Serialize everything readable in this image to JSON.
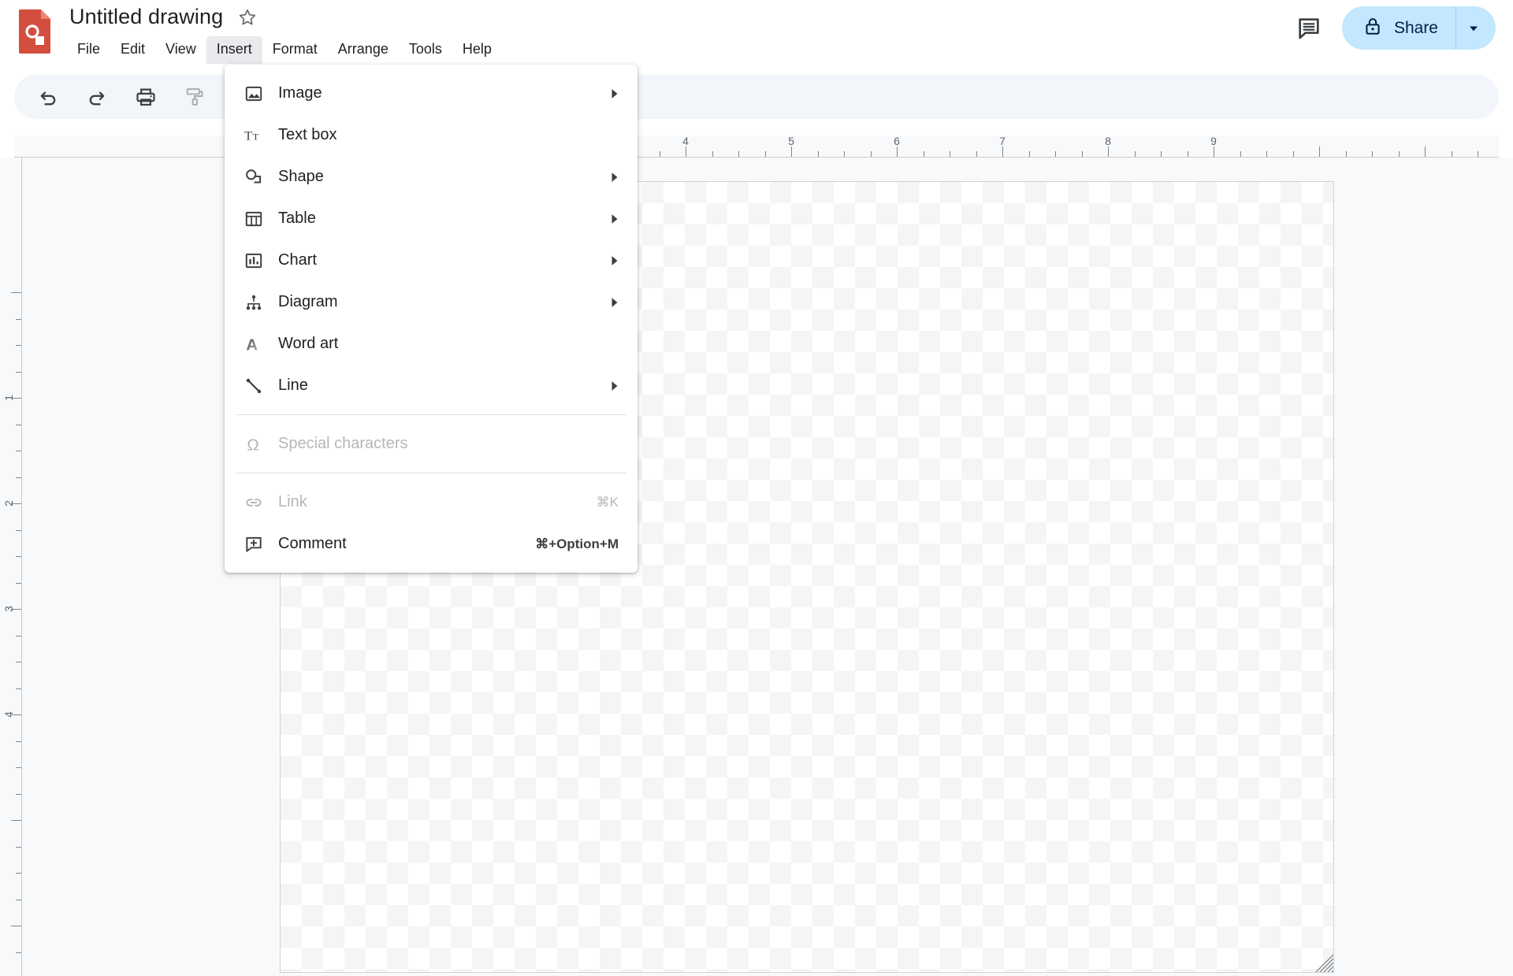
{
  "app": {
    "logo_icon": "google-drawings-logo",
    "logo_color": "#d34e3e"
  },
  "header": {
    "doc_title": "Untitled drawing",
    "star_icon": "star-outline-icon",
    "comment_history_icon": "comment-history-icon",
    "share": {
      "label": "Share",
      "lock_icon": "lock-icon",
      "caret_icon": "chevron-down-icon",
      "bg_color": "#c2e7ff",
      "text_color": "#041e49"
    }
  },
  "menubar": {
    "items": [
      {
        "label": "File",
        "active": false
      },
      {
        "label": "Edit",
        "active": false
      },
      {
        "label": "View",
        "active": false
      },
      {
        "label": "Insert",
        "active": true
      },
      {
        "label": "Format",
        "active": false
      },
      {
        "label": "Arrange",
        "active": false
      },
      {
        "label": "Tools",
        "active": false
      },
      {
        "label": "Help",
        "active": false
      }
    ]
  },
  "toolbar": {
    "items": [
      {
        "name": "undo-icon",
        "disabled": false
      },
      {
        "name": "redo-icon",
        "disabled": false
      },
      {
        "name": "print-icon",
        "disabled": false
      },
      {
        "name": "paint-format-icon",
        "disabled": true
      },
      {
        "name": "zoom-in-icon",
        "disabled": false
      }
    ]
  },
  "insert_menu": {
    "groups": [
      {
        "items": [
          {
            "label": "Image",
            "icon": "image-icon",
            "submenu": true,
            "disabled": false,
            "shortcut": ""
          },
          {
            "label": "Text box",
            "icon": "text-box-icon",
            "submenu": false,
            "disabled": false,
            "shortcut": ""
          },
          {
            "label": "Shape",
            "icon": "shape-icon",
            "submenu": true,
            "disabled": false,
            "shortcut": ""
          },
          {
            "label": "Table",
            "icon": "table-icon",
            "submenu": true,
            "disabled": false,
            "shortcut": ""
          },
          {
            "label": "Chart",
            "icon": "chart-icon",
            "submenu": true,
            "disabled": false,
            "shortcut": ""
          },
          {
            "label": "Diagram",
            "icon": "diagram-icon",
            "submenu": true,
            "disabled": false,
            "shortcut": ""
          },
          {
            "label": "Word art",
            "icon": "word-art-icon",
            "submenu": false,
            "disabled": false,
            "shortcut": ""
          },
          {
            "label": "Line",
            "icon": "line-icon",
            "submenu": true,
            "disabled": false,
            "shortcut": ""
          }
        ]
      },
      {
        "items": [
          {
            "label": "Special characters",
            "icon": "omega-icon",
            "submenu": false,
            "disabled": true,
            "shortcut": ""
          }
        ]
      },
      {
        "items": [
          {
            "label": "Link",
            "icon": "link-icon",
            "submenu": false,
            "disabled": true,
            "shortcut": "⌘K"
          },
          {
            "label": "Comment",
            "icon": "add-comment-icon",
            "submenu": false,
            "disabled": false,
            "shortcut": "⌘+Option+M"
          }
        ]
      }
    ]
  },
  "ruler_horizontal": {
    "unit_labels": [
      "4",
      "5",
      "6",
      "7",
      "8",
      "9"
    ]
  },
  "ruler_vertical": {
    "unit_labels": [
      "1",
      "2",
      "3",
      "4"
    ]
  },
  "canvas": {
    "name": "drawing-canvas",
    "resize_handle": "resize-grip"
  }
}
